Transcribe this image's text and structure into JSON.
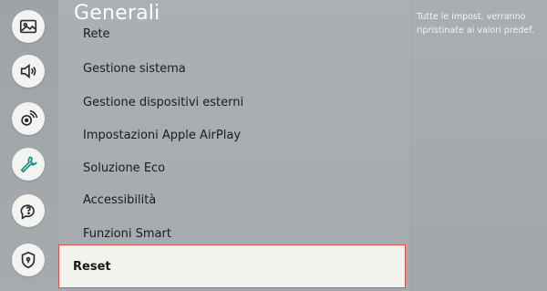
{
  "rail": {
    "items": [
      {
        "icon": "picture-icon",
        "active": false
      },
      {
        "icon": "sound-icon",
        "active": false
      },
      {
        "icon": "broadcast-icon",
        "active": false
      },
      {
        "icon": "wrench-icon",
        "active": true
      },
      {
        "icon": "support-icon",
        "active": false
      },
      {
        "icon": "privacy-shield-icon",
        "active": false
      }
    ]
  },
  "panel": {
    "title": "Generali",
    "items": [
      {
        "label": "Rete"
      },
      {
        "label": "Gestione sistema"
      },
      {
        "label": "Gestione dispositivi esterni"
      },
      {
        "label": "Impostazioni Apple AirPlay"
      },
      {
        "label": "Soluzione Eco"
      },
      {
        "label": "Accessibilità"
      },
      {
        "label": "Funzioni Smart"
      }
    ],
    "selected": {
      "label": "Reset"
    }
  },
  "info": {
    "text": "Tutte le impost. verranno ripristinate ai valori predef."
  },
  "colors": {
    "active_icon": "#1f8f83",
    "icon": "#2b2b2b",
    "selection_border": "#d5524d"
  }
}
